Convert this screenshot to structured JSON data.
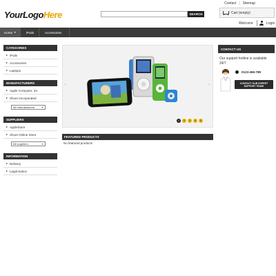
{
  "header": {
    "logo_part1": "YourLogo",
    "logo_part2": "Here",
    "top_links": [
      "Contact",
      "Sitemap"
    ],
    "search_placeholder": "",
    "search_button": "SEARCH",
    "cart_label": "Cart (empty)",
    "welcome": "Welcome",
    "login": "Login"
  },
  "nav": {
    "items": [
      {
        "label": "Home",
        "active": true
      },
      {
        "label": "iPods"
      },
      {
        "label": "Accessories"
      }
    ]
  },
  "left": {
    "categories": {
      "title": "CATEGORIES",
      "items": [
        "iPods",
        "Accessories",
        "Laptops"
      ]
    },
    "manufacturers": {
      "title": "MANUFACTURERS",
      "items": [
        "Apple Computer, Inc",
        "Shure Incorporated"
      ],
      "select_value": "All manufacturers"
    },
    "suppliers": {
      "title": "SUPPLIERS",
      "items": [
        "AppleStore",
        "Shure Online Store"
      ],
      "select_value": "All suppliers"
    },
    "information": {
      "title": "INFORMATION",
      "items": [
        "Delivery",
        "Legal Notice"
      ]
    }
  },
  "center": {
    "slider": {
      "pages": [
        "1",
        "2",
        "3",
        "4",
        "5"
      ],
      "active_page": 1
    },
    "featured_title": "FEATURED PRODUCTS",
    "no_products": "No featured products"
  },
  "right": {
    "contact_title": "CONTACT US",
    "hotline_text": "Our support hotline is available 24/7",
    "phone": "0123-456-789",
    "support_button": "CONTACT OUR EXPERT SUPPORT TEAM!"
  },
  "colors": {
    "dark_bar": "#333333",
    "logo_accent": "#e8a800",
    "pager_dot": "#e8b400"
  }
}
